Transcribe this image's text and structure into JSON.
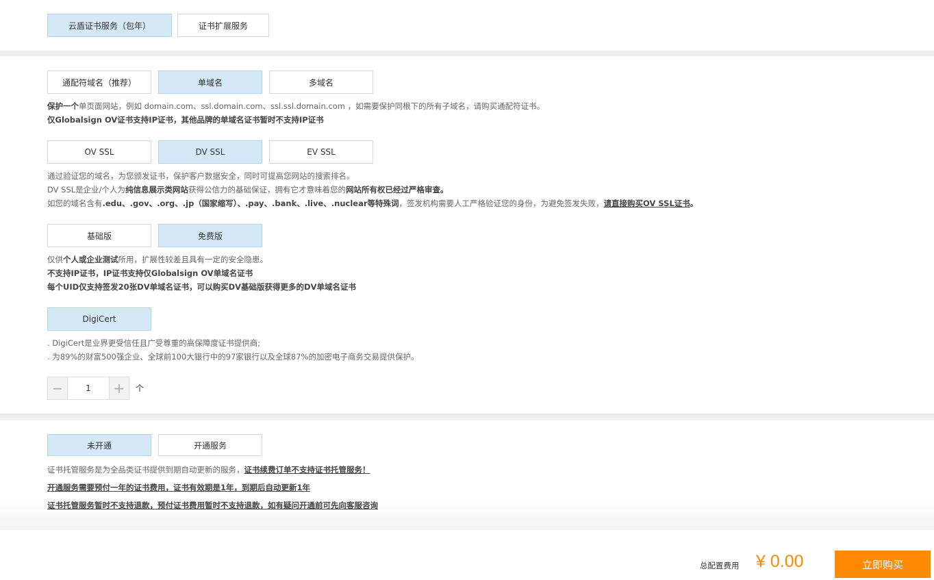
{
  "service_tabs": {
    "cert": "云盾证书服务（包年）",
    "ext": "证书扩展服务"
  },
  "domain_type": {
    "options": [
      "通配符域名（推荐）",
      "单域名",
      "多域名"
    ],
    "desc1_bold": "保护一个",
    "desc1_rest": "单页面网站，例如 domain.com、ssl.domain.com、ssl.ssl.domain.com ，如需要保护同根下的所有子域名，请购买通配符证书。",
    "desc2": "仅Globalsign OV证书支持IP证书，其他品牌的单域名证书暂时不支持IP证书"
  },
  "cert_type": {
    "options": [
      "OV SSL",
      "DV SSL",
      "EV SSL"
    ],
    "line1": "通过验证您的域名，为您颁发证书，保护客户数据安全，同时可提高您网站的搜索排名。",
    "line2_a": "DV SSL是企业/个人为",
    "line2_b": "纯信息展示类网站",
    "line2_c": "获得公信力的基础保证，拥有它才意味着您的",
    "line2_d": "网站所有权已经过严格审查。",
    "line3_a": "如您的域名含有",
    "line3_b": ".edu、.gov、.org、.jp（国家缩写）、.pay、.bank、.live、.nuclear等特殊词",
    "line3_c": "，签发机构需要人工严格验证您的身份，为避免签发失败，",
    "line3_d": "请直接购买OV SSL证书",
    "line3_e": "。"
  },
  "edition": {
    "options": [
      "基础版",
      "免费版"
    ],
    "line1_a": "仅供",
    "line1_b": "个人或企业测试",
    "line1_c": "所用，扩展性较差且具有一定的安全隐患。",
    "line2": "不支持IP证书，IP证书支持仅Globalsign OV单域名证书",
    "line3": "每个UID仅支持签发20张DV单域名证书，可以购买DV基础版获得更多的DV单域名证书"
  },
  "brand": {
    "option": "DigiCert",
    "line1": ". DigiCert是业界更受信任且广受尊重的高保障度证书提供商;",
    "line2": ". 为89%的财富500强企业、全球前100大银行中的97家银行以及全球87%的加密电子商务交易提供保护。"
  },
  "quantity": {
    "minus": "−",
    "value": "1",
    "plus": "+",
    "unit": "个"
  },
  "hosting": {
    "options": [
      "未开通",
      "开通服务"
    ],
    "line1_a": "证书托管服务是为全品类证书提供到期自动更新的服务，",
    "line1_b": "证书续费订单不支持证书托管服务！",
    "line2": "开通服务需要预付一年的证书费用，证书有效期是1年，到期后自动更新1年",
    "line3": "证书托管服务暂时不支持退款，预付证书费用暂时不支持退款，如有疑问开通前可先向客服咨询"
  },
  "footer": {
    "total_label": "总配置费用",
    "price": "¥ 0.00",
    "buy_label": "立即购买"
  },
  "colors": {
    "selected_bg": "#d4e8f6",
    "accent": "#ff8a00"
  }
}
